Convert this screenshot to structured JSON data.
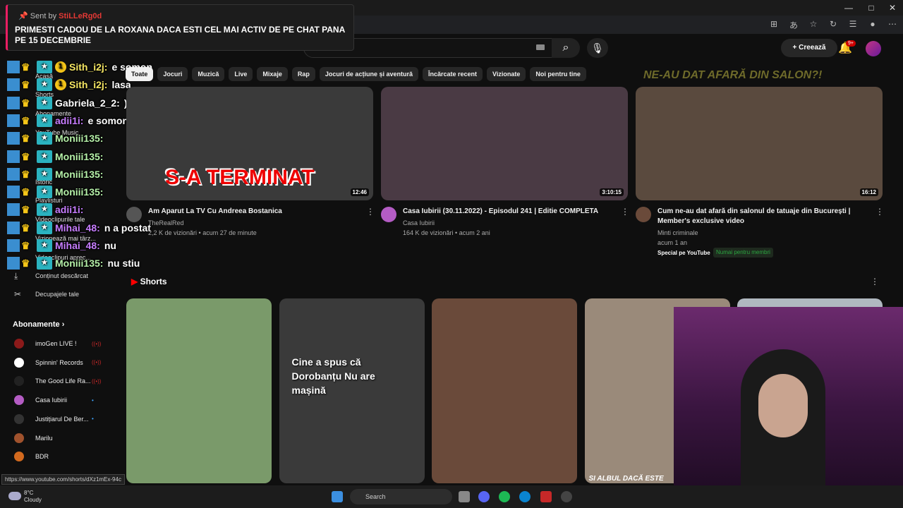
{
  "window": {
    "minimize": "—",
    "maximize": "□",
    "close": "✕"
  },
  "notification": {
    "sent_by_label": "Sent by",
    "sender": "StiLLeRg0d",
    "text": "PRIMESTI CADOU DE LA ROXANA DACA ESTI CEL MAI ACTIV DE PE CHAT PANA PE 15 DECEMBRIE"
  },
  "header": {
    "create_label": "Creează",
    "notif_count": "9+"
  },
  "chips": [
    "Toate",
    "Jocuri",
    "Muzică",
    "Live",
    "Mixaje",
    "Rap",
    "Jocuri de acțiune și aventură",
    "Încărcate recent",
    "Vizionate",
    "Noi pentru tine"
  ],
  "sticker": "NE-AU DAT AFARĂ DIN SALON?!",
  "sidebar": {
    "items": [
      {
        "label": "Acasă"
      },
      {
        "label": "Shorts"
      },
      {
        "label": "Abonamente"
      },
      {
        "label": "YouTube Music"
      },
      {
        "label": "Istoric"
      },
      {
        "label": "Playlisturi"
      },
      {
        "label": "Videoclipurile tale"
      },
      {
        "label": "Vizionează mai târz..."
      },
      {
        "label": "Videoclipuri aprec..."
      },
      {
        "label": "Conținut descărcat"
      },
      {
        "label": "Decupajele tale"
      }
    ],
    "subs_title": "Abonamente",
    "subs": [
      {
        "name": "imoGen LIVE !",
        "color": "#8b1a1a",
        "live": "((•))"
      },
      {
        "name": "Spinnin' Records",
        "color": "#ffffff",
        "live": "((•))"
      },
      {
        "name": "The Good Life Ra...",
        "color": "#222222",
        "live": "((•))"
      },
      {
        "name": "Casa Iubirii",
        "color": "#b45cc4",
        "live": "•"
      },
      {
        "name": "Justițiarul De Ber...",
        "color": "#333333",
        "live": "•"
      },
      {
        "name": "Marilu",
        "color": "#a0522d",
        "live": ""
      },
      {
        "name": "BDR",
        "color": "#d2691e",
        "live": ""
      }
    ]
  },
  "chat": [
    {
      "user": "Sith_i2j:",
      "msg": "e somon",
      "color": "#f5e663",
      "extra": "1"
    },
    {
      "user": "Sith_i2j:",
      "msg": "lasa",
      "color": "#f5e663",
      "extra": "1"
    },
    {
      "user": "Gabriela_2_2:",
      "msg": ")))))",
      "color": "#ffffff",
      "extra": ""
    },
    {
      "user": "adii1i:",
      "msg": "e somon fac sushi",
      "color": "#c77dff",
      "extra": ""
    },
    {
      "user": "Moniii135:",
      "msg": "",
      "color": "#b5f0a8",
      "extra": ""
    },
    {
      "user": "Moniii135:",
      "msg": "",
      "color": "#b5f0a8",
      "extra": ""
    },
    {
      "user": "Moniii135:",
      "msg": "",
      "color": "#b5f0a8",
      "extra": ""
    },
    {
      "user": "Moniii135:",
      "msg": "",
      "color": "#b5f0a8",
      "extra": ""
    },
    {
      "user": "adii1i:",
      "msg": "",
      "color": "#c77dff",
      "extra": ""
    },
    {
      "user": "Mihai_48:",
      "msg": "n a postat",
      "color": "#c77dff",
      "extra": ""
    },
    {
      "user": "Mihai_48:",
      "msg": "nu",
      "color": "#c77dff",
      "extra": ""
    },
    {
      "user": "Moniii135:",
      "msg": "nu stiu",
      "color": "#b5f0a8",
      "extra": ""
    }
  ],
  "videos": [
    {
      "title": "Am Aparut La TV Cu Andreea Bostanica",
      "channel": "TheRealRed",
      "stats": "2,2 K de vizionări • acum 27 de minute",
      "duration": "12:46",
      "thumb_text": "S-A TERMINAT",
      "thumb_color": "#3a3a3a"
    },
    {
      "title": "Casa Iubirii (30.11.2022) - Episodul 241 | Editie COMPLETA",
      "channel": "Casa Iubirii",
      "stats": "164 K de vizionări • acum 2 ani",
      "duration": "3:10:15",
      "thumb_text": "",
      "thumb_color": "#4a3a44"
    },
    {
      "title": "Cum ne-au dat afară din salonul de tatuaje din București | Member's exclusive video",
      "channel": "Minti criminale",
      "stats": "acum 1 an",
      "duration": "16:12",
      "thumb_text": "",
      "thumb_color": "#5a4a3e",
      "badge1": "Special pe YouTube",
      "badge2": "Numai pentru membri"
    }
  ],
  "shorts": {
    "title": "Shorts",
    "items": [
      {
        "caption": "",
        "color": "#7a9a6a"
      },
      {
        "caption": "Cine a spus că Dorobanțu Nu are mașină",
        "color": "#3a3a3a"
      },
      {
        "caption": "",
        "color": "#6a4a3a"
      },
      {
        "caption": "SI ALBUL DACĂ ESTE",
        "color": "#9a8a7a"
      },
      {
        "caption": "",
        "color": "#b0b8c0"
      }
    ]
  },
  "status_url": "https://www.youtube.com/shorts/dXz1mEx-94c",
  "taskbar": {
    "temp": "8°C",
    "weather": "Cloudy",
    "search": "Search"
  }
}
